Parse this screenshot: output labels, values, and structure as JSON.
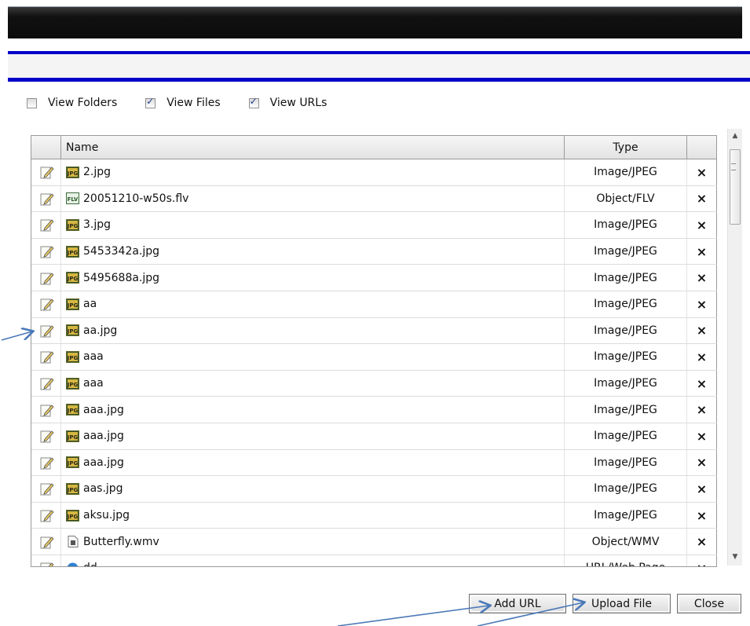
{
  "filters": {
    "view_folders": {
      "label": "View Folders",
      "checked": false
    },
    "view_files": {
      "label": "View Files",
      "checked": true
    },
    "view_urls": {
      "label": "View URLs",
      "checked": true
    }
  },
  "table": {
    "columns": {
      "name": "Name",
      "type": "Type"
    },
    "delete_glyph": "×",
    "rows": [
      {
        "name": "2.jpg",
        "type": "Image/JPEG",
        "icon": "jpg-file-icon"
      },
      {
        "name": "20051210-w50s.flv",
        "type": "Object/FLV",
        "icon": "flv-file-icon"
      },
      {
        "name": "3.jpg",
        "type": "Image/JPEG",
        "icon": "jpg-file-icon"
      },
      {
        "name": "5453342a.jpg",
        "type": "Image/JPEG",
        "icon": "jpg-file-icon"
      },
      {
        "name": "5495688a.jpg",
        "type": "Image/JPEG",
        "icon": "jpg-file-icon"
      },
      {
        "name": "aa",
        "type": "Image/JPEG",
        "icon": "jpg-file-icon"
      },
      {
        "name": "aa.jpg",
        "type": "Image/JPEG",
        "icon": "jpg-file-icon"
      },
      {
        "name": "aaa",
        "type": "Image/JPEG",
        "icon": "jpg-file-icon"
      },
      {
        "name": "aaa",
        "type": "Image/JPEG",
        "icon": "jpg-file-icon"
      },
      {
        "name": "aaa.jpg",
        "type": "Image/JPEG",
        "icon": "jpg-file-icon"
      },
      {
        "name": "aaa.jpg",
        "type": "Image/JPEG",
        "icon": "jpg-file-icon"
      },
      {
        "name": "aaa.jpg",
        "type": "Image/JPEG",
        "icon": "jpg-file-icon"
      },
      {
        "name": "aas.jpg",
        "type": "Image/JPEG",
        "icon": "jpg-file-icon"
      },
      {
        "name": "aksu.jpg",
        "type": "Image/JPEG",
        "icon": "jpg-file-icon"
      },
      {
        "name": "Butterfly.wmv",
        "type": "Object/WMV",
        "icon": "wmv-file-icon"
      },
      {
        "name": "dd",
        "type": "URL/Web Page",
        "icon": "globe-icon"
      }
    ]
  },
  "buttons": {
    "add_url": "Add URL",
    "upload_file": "Upload File",
    "close": "Close"
  },
  "colors": {
    "header_dark": "#111111",
    "accent_blue": "#0000c8",
    "annotation_arrow": "#4a78b8"
  }
}
